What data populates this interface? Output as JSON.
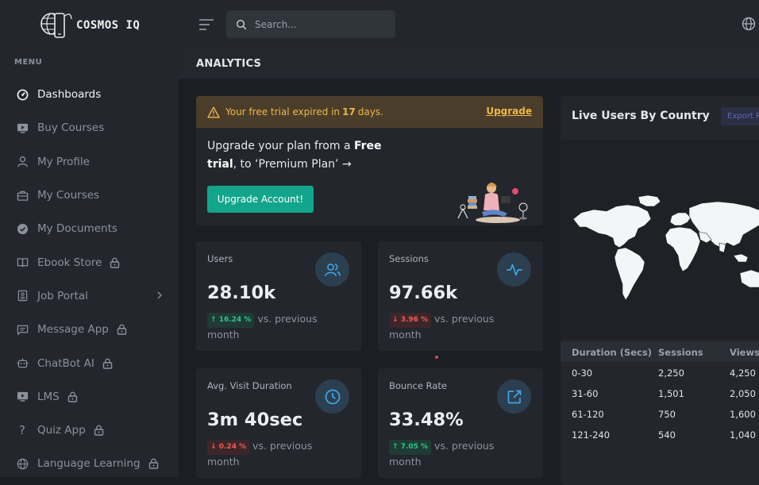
{
  "app": {
    "name": "COSMOS IQ"
  },
  "sidebar": {
    "menu_label": "MENU",
    "items": [
      {
        "label": "Dashboards",
        "icon": "dashboard-gauge-icon",
        "active": true
      },
      {
        "label": "Buy Courses",
        "icon": "monitor-play-icon"
      },
      {
        "label": "My Profile",
        "icon": "user-icon"
      },
      {
        "label": "My Courses",
        "icon": "briefcase-icon"
      },
      {
        "label": "My Documents",
        "icon": "check-badge-icon"
      },
      {
        "label": "Ebook Store",
        "icon": "book-open-icon",
        "locked": true
      },
      {
        "label": "Job Portal",
        "icon": "document-icon",
        "submenu": true
      },
      {
        "label": "Message App",
        "icon": "message-icon",
        "locked": true
      },
      {
        "label": "ChatBot AI",
        "icon": "bot-icon",
        "locked": true
      },
      {
        "label": "LMS",
        "icon": "monitor-play-icon",
        "locked": true
      },
      {
        "label": "Quiz App",
        "icon": "question-icon",
        "locked": true
      },
      {
        "label": "Language Learning",
        "icon": "globe-icon",
        "locked": true
      }
    ]
  },
  "topbar": {
    "search_placeholder": "Search..."
  },
  "page": {
    "title": "ANALYTICS"
  },
  "trial": {
    "prefix": "Your free trial expired in",
    "days": "17",
    "suffix": "days.",
    "upgrade_link": "Upgrade",
    "msg_part1": "Upgrade your plan from a",
    "msg_bold": "Free trial",
    "msg_part2": ", to ‘Premium Plan’ →",
    "button": "Upgrade Account!"
  },
  "stats": [
    {
      "label": "Users",
      "value": "28.10k",
      "change": "16.24 %",
      "direction": "up",
      "trend_text": "vs. previous month",
      "icon": "users-icon"
    },
    {
      "label": "Sessions",
      "value": "97.66k",
      "change": "3.96 %",
      "direction": "down",
      "trend_text": "vs. previous month",
      "icon": "activity-icon"
    },
    {
      "label": "Avg. Visit Duration",
      "value": "3m 40sec",
      "change": "0.24 %",
      "direction": "down",
      "trend_text": "vs. previous month",
      "icon": "clock-icon"
    },
    {
      "label": "Bounce Rate",
      "value": "33.48%",
      "change": "7.05 %",
      "direction": "up",
      "trend_text": "vs. previous month",
      "icon": "external-link-icon"
    }
  ],
  "live_users": {
    "title": "Live Users By Country",
    "export_label": "Export Report",
    "columns": [
      "Duration (Secs)",
      "Sessions",
      "Views"
    ],
    "rows": [
      [
        "0-30",
        "2,250",
        "4,250"
      ],
      [
        "31-60",
        "1,501",
        "2,050"
      ],
      [
        "61-120",
        "750",
        "1,600"
      ],
      [
        "121-240",
        "540",
        "1,040"
      ]
    ]
  },
  "colors": {
    "accent": "#13a58c",
    "warning": "#f0b64a",
    "up": "#2fc492",
    "down": "#ef5b57",
    "icon_blue": "#3ea7e8"
  }
}
